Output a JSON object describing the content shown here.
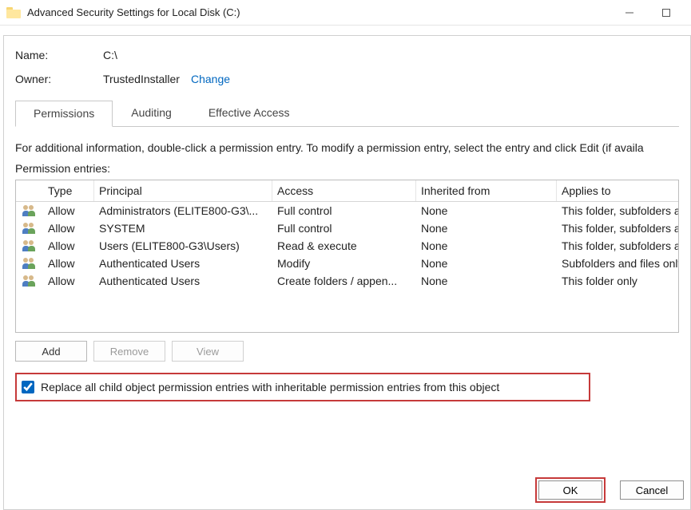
{
  "window": {
    "title": "Advanced Security Settings for Local Disk (C:)"
  },
  "meta": {
    "name_label": "Name:",
    "name_value": "C:\\",
    "owner_label": "Owner:",
    "owner_value": "TrustedInstaller",
    "change_label": "Change"
  },
  "tabs": {
    "permissions": "Permissions",
    "auditing": "Auditing",
    "effective_access": "Effective Access"
  },
  "info_text": "For additional information, double-click a permission entry. To modify a permission entry, select the entry and click Edit (if availa",
  "entries_label": "Permission entries:",
  "headers": {
    "type": "Type",
    "principal": "Principal",
    "access": "Access",
    "inherited_from": "Inherited from",
    "applies_to": "Applies to"
  },
  "rows": [
    {
      "type": "Allow",
      "principal": "Administrators (ELITE800-G3\\...",
      "access": "Full control",
      "inherited": "None",
      "applies": "This folder, subfolders and"
    },
    {
      "type": "Allow",
      "principal": "SYSTEM",
      "access": "Full control",
      "inherited": "None",
      "applies": "This folder, subfolders and"
    },
    {
      "type": "Allow",
      "principal": "Users (ELITE800-G3\\Users)",
      "access": "Read & execute",
      "inherited": "None",
      "applies": "This folder, subfolders and"
    },
    {
      "type": "Allow",
      "principal": "Authenticated Users",
      "access": "Modify",
      "inherited": "None",
      "applies": "Subfolders and files only"
    },
    {
      "type": "Allow",
      "principal": "Authenticated Users",
      "access": "Create folders / appen...",
      "inherited": "None",
      "applies": "This folder only"
    }
  ],
  "buttons": {
    "add": "Add",
    "remove": "Remove",
    "view": "View"
  },
  "checkbox": {
    "label": "Replace all child object permission entries with inheritable permission entries from this object",
    "checked": true
  },
  "footer": {
    "ok": "OK",
    "cancel": "Cancel"
  }
}
